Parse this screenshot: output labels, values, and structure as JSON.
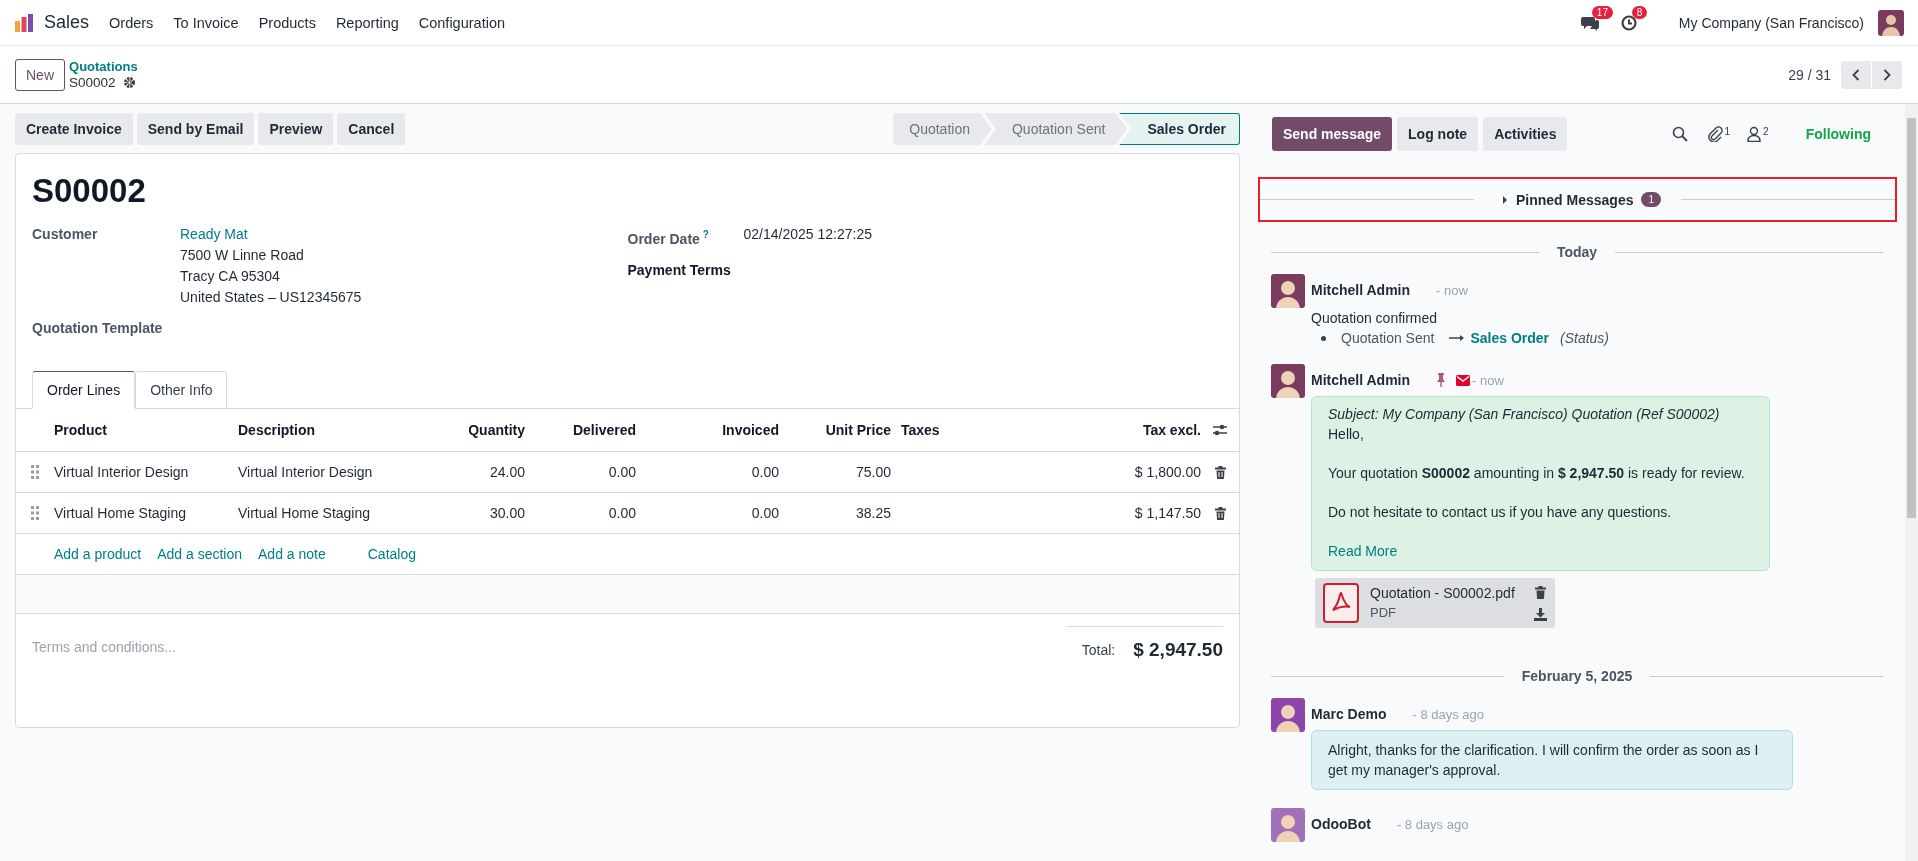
{
  "navbar": {
    "app": "Sales",
    "menus": [
      "Orders",
      "To Invoice",
      "Products",
      "Reporting",
      "Configuration"
    ],
    "messages_badge": "17",
    "activities_badge": "8",
    "company": "My Company (San Francisco)"
  },
  "control_panel": {
    "new_button": "New",
    "breadcrumb": "Quotations",
    "record": "S00002",
    "pager": "29 / 31"
  },
  "action_buttons": [
    "Create Invoice",
    "Send by Email",
    "Preview",
    "Cancel"
  ],
  "status_steps": [
    {
      "label": "Quotation",
      "selected": false
    },
    {
      "label": "Quotation Sent",
      "selected": false
    },
    {
      "label": "Sales Order",
      "selected": true
    }
  ],
  "form": {
    "title": "S00002",
    "customer_label": "Customer",
    "customer_name": "Ready Mat",
    "address_lines": [
      "7500 W Linne Road",
      "Tracy CA 95304",
      "United States – US12345675"
    ],
    "template_label": "Quotation Template",
    "order_date_label": "Order Date",
    "order_date_help": "?",
    "order_date": "02/14/2025 12:27:25",
    "payment_terms_label": "Payment Terms"
  },
  "tabs": [
    {
      "label": "Order Lines",
      "selected": true
    },
    {
      "label": "Other Info",
      "selected": false
    }
  ],
  "table": {
    "columns": [
      "Product",
      "Description",
      "Quantity",
      "Delivered",
      "Invoiced",
      "Unit Price",
      "Taxes",
      "Tax excl."
    ],
    "rows": [
      {
        "cells": [
          "Virtual Interior Design",
          "Virtual Interior Design",
          "24.00",
          "0.00",
          "0.00",
          "75.00",
          "",
          "$ 1,800.00"
        ]
      },
      {
        "cells": [
          "Virtual Home Staging",
          "Virtual Home Staging",
          "30.00",
          "0.00",
          "0.00",
          "38.25",
          "",
          "$ 1,147.50"
        ]
      }
    ]
  },
  "add_links": [
    "Add a product",
    "Add a section",
    "Add a note",
    "Catalog"
  ],
  "terms_placeholder": "Terms and conditions...",
  "total_label": "Total:",
  "total": "$ 2,947.50",
  "chatter": {
    "buttons": [
      {
        "label": "Send message",
        "selected": true
      },
      {
        "label": "Log note",
        "selected": false
      },
      {
        "label": "Activities",
        "selected": false
      }
    ],
    "attachments_count": "1",
    "followers_count": "2",
    "following": "Following",
    "pinned": {
      "label": "Pinned Messages",
      "count": "1",
      "highlighted": true
    },
    "feed": [
      {
        "kind": "date",
        "label": "Today"
      },
      {
        "kind": "message",
        "author": "Mitchell Admin",
        "color": "#7a3b5e",
        "time": "- now",
        "pinned": false,
        "email": false,
        "body": {
          "kind": "tracking",
          "text": "Quotation confirmed",
          "old": "Quotation Sent",
          "new": "Sales Order",
          "field": "(Status)"
        }
      },
      {
        "kind": "message",
        "author": "Mitchell Admin",
        "color": "#7a3b5e",
        "time": "- now",
        "pinned": true,
        "email": true,
        "body": {
          "kind": "email",
          "subject": "Subject: My Company (San Francisco) Quotation (Ref S00002)",
          "paragraphs": [
            "Hello,",
            "Your quotation **S00002** amounting in **$ 2,947.50** is ready for review.",
            "Do not hesitate to contact us if you have any questions."
          ],
          "read_more": "Read More",
          "attachment": {
            "name": "Quotation - S00002.pdf",
            "type": "PDF"
          }
        }
      },
      {
        "kind": "date",
        "label": "February 5, 2025"
      },
      {
        "kind": "message",
        "author": "Marc Demo",
        "color": "#8e44ad",
        "time": "- 8 days ago",
        "pinned": false,
        "email": false,
        "body": {
          "kind": "comment",
          "text": "Alright, thanks for the clarification. I will confirm the order as soon as I get my manager's approval."
        }
      },
      {
        "kind": "message",
        "author": "OdooBot",
        "color": "#a070b8",
        "time": "- 8 days ago",
        "pinned": false,
        "email": false
      }
    ]
  }
}
